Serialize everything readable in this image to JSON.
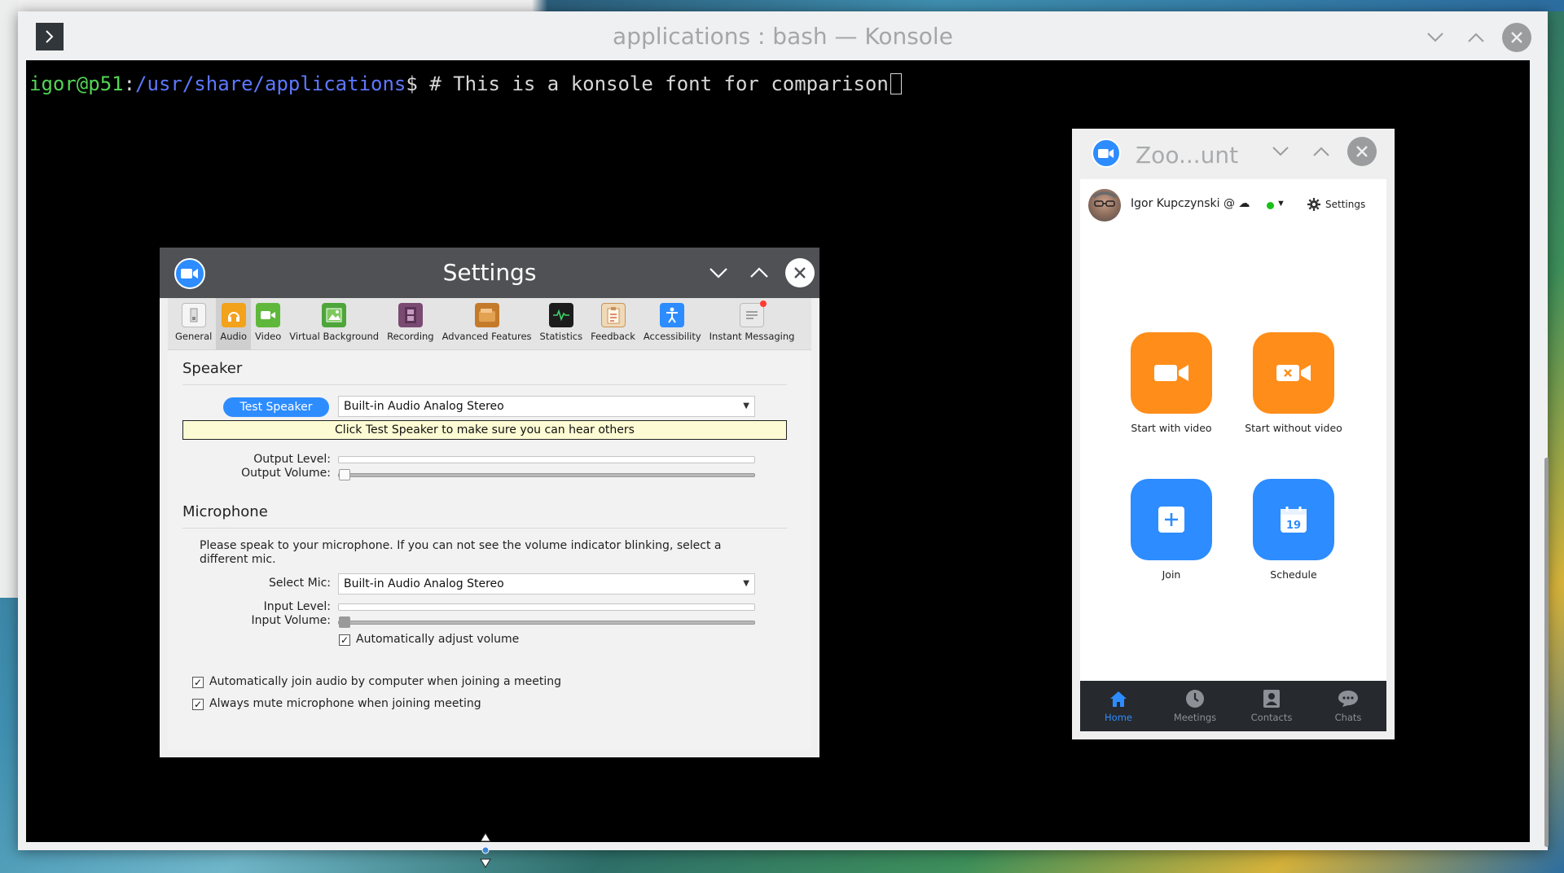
{
  "konsole": {
    "title": "applications : bash — Konsole",
    "prompt_user": "igor@p51",
    "prompt_sep": ":",
    "prompt_path": "/usr/share/applications",
    "prompt_symbol": "$ ",
    "command": "# This is a konsole font for comparison"
  },
  "settings": {
    "title": "Settings",
    "tabs": [
      {
        "label": "General",
        "icon": "general-icon"
      },
      {
        "label": "Audio",
        "icon": "audio-icon",
        "active": true
      },
      {
        "label": "Video",
        "icon": "video-icon"
      },
      {
        "label": "Virtual Background",
        "icon": "virtual-background-icon"
      },
      {
        "label": "Recording",
        "icon": "recording-icon"
      },
      {
        "label": "Advanced Features",
        "icon": "advanced-features-icon"
      },
      {
        "label": "Statistics",
        "icon": "statistics-icon"
      },
      {
        "label": "Feedback",
        "icon": "feedback-icon"
      },
      {
        "label": "Accessibility",
        "icon": "accessibility-icon"
      },
      {
        "label": "Instant Messaging",
        "icon": "instant-messaging-icon"
      }
    ],
    "speaker": {
      "heading": "Speaker",
      "test_button": "Test Speaker",
      "device": "Built-in Audio Analog Stereo",
      "hint": "Click Test Speaker to make sure you can hear others",
      "output_level_label": "Output Level:",
      "output_volume_label": "Output Volume:",
      "output_level": 0,
      "output_volume": 0
    },
    "microphone": {
      "heading": "Microphone",
      "instructions": "Please speak to your microphone. If you can not see the volume indicator blinking, select a different mic.",
      "select_label": "Select Mic:",
      "device": "Built-in Audio Analog Stereo",
      "input_level_label": "Input Level:",
      "input_volume_label": "Input Volume:",
      "input_level": 0,
      "input_volume": 0,
      "auto_adjust_label": "Automatically adjust volume",
      "auto_adjust": true
    },
    "options": [
      {
        "label": "Automatically join audio by computer when joining a meeting",
        "checked": true
      },
      {
        "label": "Always mute microphone when joining meeting",
        "checked": true
      }
    ]
  },
  "zoom_main": {
    "title": "Zoo...unt",
    "user_name": "Igor Kupczynski @ ☁",
    "status_color": "#18c018",
    "settings_label": "Settings",
    "actions": [
      {
        "label": "Start with video",
        "icon": "video-camera-icon",
        "color": "#ff8d1a"
      },
      {
        "label": "Start without video",
        "icon": "video-off-icon",
        "color": "#ff8d1a"
      },
      {
        "label": "Join",
        "icon": "plus-icon",
        "color": "#2d8cff"
      },
      {
        "label": "Schedule",
        "icon": "calendar-icon",
        "color": "#2d8cff",
        "calendar_day": "19"
      }
    ],
    "nav": [
      {
        "label": "Home",
        "icon": "home-icon",
        "active": true
      },
      {
        "label": "Meetings",
        "icon": "clock-icon"
      },
      {
        "label": "Contacts",
        "icon": "contacts-icon"
      },
      {
        "label": "Chats",
        "icon": "chat-icon"
      }
    ]
  },
  "colors": {
    "zoom_blue": "#2d8cff",
    "zoom_orange": "#ff8d1a",
    "terminal_bg": "#000000",
    "prompt_green": "#54d454",
    "prompt_blue": "#5d78ff"
  }
}
